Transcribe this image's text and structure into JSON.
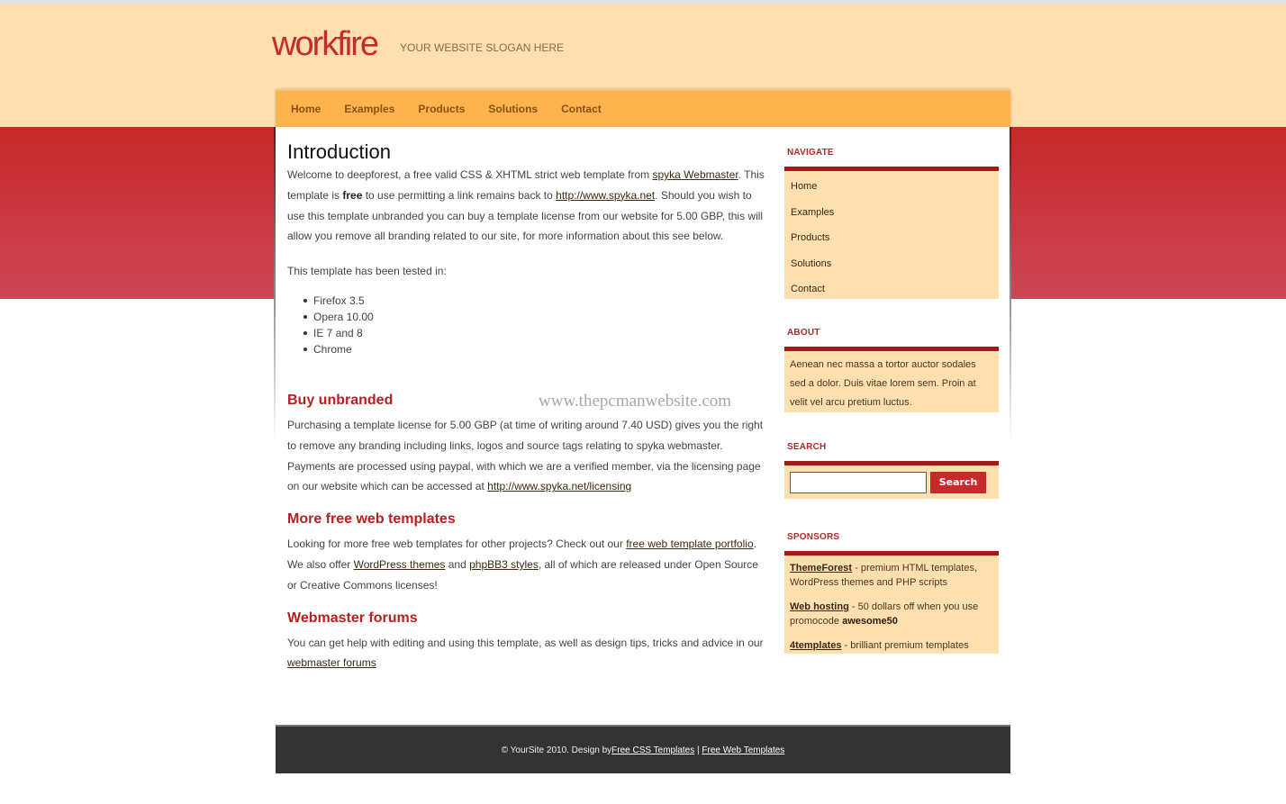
{
  "header": {
    "logo": "workfire",
    "slogan": "YOUR WEBSITE SLOGAN HERE"
  },
  "nav": {
    "items": [
      {
        "label": "Home"
      },
      {
        "label": "Examples"
      },
      {
        "label": "Products"
      },
      {
        "label": "Solutions"
      },
      {
        "label": "Contact"
      }
    ]
  },
  "content": {
    "intro": {
      "title": "Introduction",
      "p1_a": "Welcome to deepforest, a free valid CSS & XHTML strict web template from ",
      "p1_link1": "spyka Webmaster",
      "p1_b": ". This template is ",
      "p1_bold": "free",
      "p1_c": " to use permitting a link remains back to ",
      "p1_link2": "http://www.spyka.net",
      "p1_d": ". Should you wish to use this template unbranded you can buy a template license from our website for 5.00 GBP, this will allow you remove all branding related to our site, for more information about this see below.",
      "tested_label": "This template has been tested in:",
      "browsers": [
        "Firefox 3.5",
        "Opera 10.00",
        "IE 7 and 8",
        "Chrome"
      ]
    },
    "watermark": "www.thepcmanwebsite.com",
    "buy": {
      "title": "Buy unbranded",
      "text": "Purchasing a template license for 5.00 GBP (at time of writing around 7.40 USD) gives you the right to remove any branding including links, logos and source tags relating to spyka webmaster. Payments are processed using paypal, with which we are a verified member, via the licensing page on our website which can be accessed at ",
      "link": "http://www.spyka.net/licensing"
    },
    "more": {
      "title": "More free web templates",
      "text_a": "Looking for more free web templates for other projects? Check out our ",
      "link1": "free web template portfolio",
      "text_b": ". We also offer ",
      "link2": "WordPress themes",
      "text_c": " and ",
      "link3": "phpBB3 styles",
      "text_d": ", all of which are released under Open Source or Creative Commons licenses!"
    },
    "forums": {
      "title": "Webmaster forums",
      "text": "You can get help with editing and using this template, as well as design tips, tricks and advice in our ",
      "link": "webmaster forums"
    }
  },
  "sidebar": {
    "navigate": {
      "title": "NAVIGATE",
      "items": [
        "Home",
        "Examples",
        "Products",
        "Solutions",
        "Contact"
      ]
    },
    "about": {
      "title": "ABOUT",
      "text": "Aenean nec massa a tortor auctor sodales sed a dolor. Duis vitae lorem sem. Proin at velit vel arcu pretium luctus."
    },
    "search": {
      "title": "SEARCH",
      "input_value": "",
      "button_label": "Search"
    },
    "sponsors": {
      "title": "SPONSORS",
      "items": [
        {
          "link": "ThemeForest",
          "text": " - premium HTML templates, WordPress themes and PHP scripts",
          "bold": ""
        },
        {
          "link": "Web hosting",
          "text": " - 50 dollars off when you use promocode ",
          "bold": "awesome50"
        },
        {
          "link": "4templates",
          "text": " - brilliant premium templates",
          "bold": ""
        }
      ]
    }
  },
  "footer": {
    "text": "© YourSite 2010. Design by ",
    "link1": "Free CSS Templates",
    "sep": " | ",
    "link2": "Free Web Templates"
  },
  "colors": {
    "cream": "#fee0b0",
    "red": "#c62828",
    "nav_orange": "#fdb44f",
    "heading_red": "#b52020",
    "footer_dark": "#333333"
  }
}
